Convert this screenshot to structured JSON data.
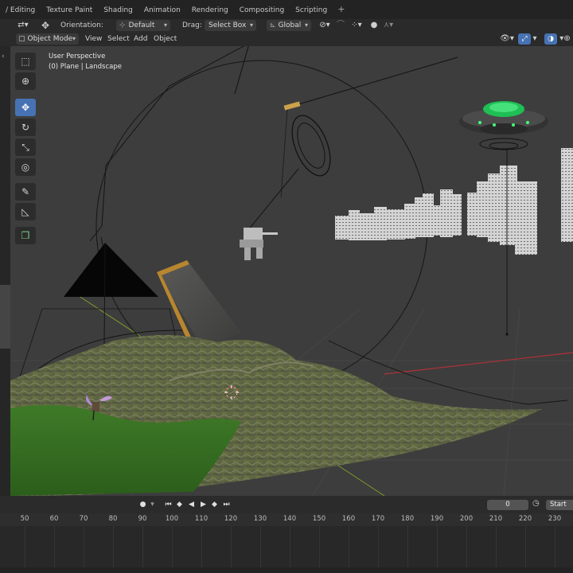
{
  "workspace_tabs": [
    "/ Editing",
    "Texture Paint",
    "Shading",
    "Animation",
    "Rendering",
    "Compositing",
    "Scripting"
  ],
  "add_tab": "+",
  "tool_header": {
    "orientation_label": "Orientation:",
    "orientation_value": "Default",
    "drag_label": "Drag:",
    "drag_value": "Select Box",
    "transform_space": "Global"
  },
  "viewport_header": {
    "mode": "Object Mode",
    "menus": [
      "View",
      "Select",
      "Add",
      "Object"
    ]
  },
  "viewport_info": {
    "line1": "User Perspective",
    "line2": "(0) Plane | Landscape"
  },
  "toolbar": [
    "select-box",
    "cursor",
    "move",
    "rotate",
    "scale",
    "transform",
    "annotate",
    "measure",
    "add-cube"
  ],
  "timeline": {
    "current_frame": "0",
    "start_label": "Start",
    "ruler_ticks": [
      "50",
      "60",
      "70",
      "80",
      "90",
      "100",
      "110",
      "120",
      "130",
      "140",
      "150",
      "160",
      "170",
      "180",
      "190",
      "200",
      "210",
      "220",
      "230"
    ]
  },
  "colors": {
    "accent": "#4772b3",
    "viewport_bg": "#3d3d3d",
    "header_bg": "#2a2a2a",
    "x_axis": "#b0303a",
    "y_axis": "#7b9a2a"
  }
}
